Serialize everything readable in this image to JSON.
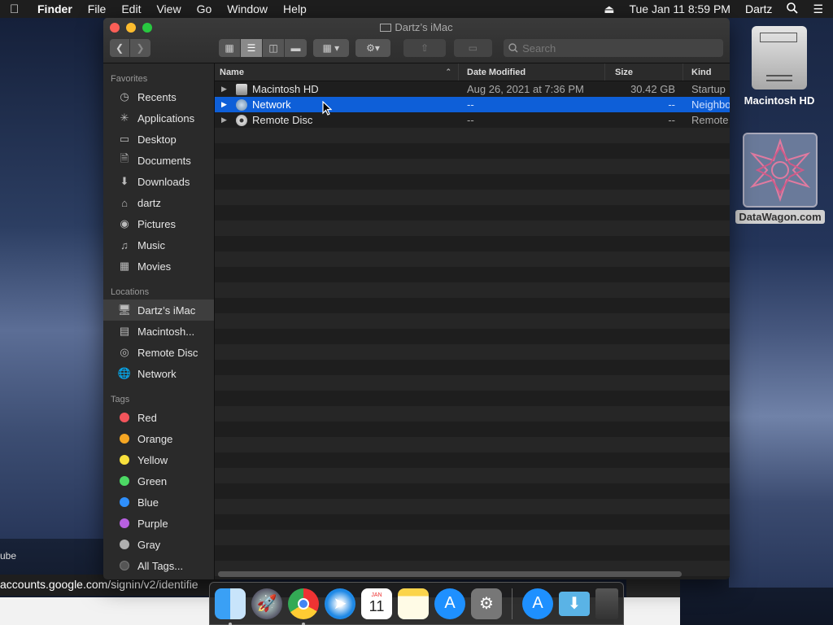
{
  "menubar": {
    "apple": "",
    "items": [
      "Finder",
      "File",
      "Edit",
      "View",
      "Go",
      "Window",
      "Help"
    ],
    "datetime": "Tue Jan 11  8:59 PM",
    "user": "Dartz"
  },
  "window": {
    "title": "Dartz’s iMac",
    "search_placeholder": "Search",
    "columns": {
      "name": "Name",
      "date": "Date Modified",
      "size": "Size",
      "kind": "Kind"
    },
    "rows": [
      {
        "name": "Macintosh HD",
        "date": "Aug 26, 2021 at 7:36 PM",
        "size": "30.42 GB",
        "kind": "Startup",
        "selected": false
      },
      {
        "name": "Network",
        "date": "--",
        "size": "--",
        "kind": "Neighbo",
        "selected": true
      },
      {
        "name": "Remote Disc",
        "date": "--",
        "size": "--",
        "kind": "Remote",
        "selected": false
      }
    ]
  },
  "sidebar": {
    "favorites_header": "Favorites",
    "favorites": [
      {
        "label": "Recents",
        "icon": "clock-icon"
      },
      {
        "label": "Applications",
        "icon": "applications-icon"
      },
      {
        "label": "Desktop",
        "icon": "desktop-icon"
      },
      {
        "label": "Documents",
        "icon": "document-icon"
      },
      {
        "label": "Downloads",
        "icon": "download-icon"
      },
      {
        "label": "dartz",
        "icon": "home-icon"
      },
      {
        "label": "Pictures",
        "icon": "camera-icon"
      },
      {
        "label": "Music",
        "icon": "music-icon"
      },
      {
        "label": "Movies",
        "icon": "film-icon"
      }
    ],
    "locations_header": "Locations",
    "locations": [
      {
        "label": "Dartz’s iMac",
        "icon": "computer-icon"
      },
      {
        "label": "Macintosh...",
        "icon": "hard-drive-icon"
      },
      {
        "label": "Remote Disc",
        "icon": "disc-icon"
      },
      {
        "label": "Network",
        "icon": "globe-icon"
      }
    ],
    "tags_header": "Tags",
    "tags": [
      {
        "label": "Red",
        "color": "#f2545b"
      },
      {
        "label": "Orange",
        "color": "#f5a623"
      },
      {
        "label": "Yellow",
        "color": "#f7e03c"
      },
      {
        "label": "Green",
        "color": "#4cd964"
      },
      {
        "label": "Blue",
        "color": "#2f8ffc"
      },
      {
        "label": "Purple",
        "color": "#b860e0"
      },
      {
        "label": "Gray",
        "color": "#b0b0b0"
      },
      {
        "label": "All Tags...",
        "color": "#555555"
      }
    ]
  },
  "desktop": {
    "hd_label": "Macintosh HD",
    "datawagon_label": "DataWagon.com"
  },
  "background": {
    "text_fragment": "ube",
    "url_fragment": "accounts.google.com/signin/v2/identifie"
  },
  "dock": {
    "calendar_month": "JAN",
    "calendar_day": "11"
  }
}
